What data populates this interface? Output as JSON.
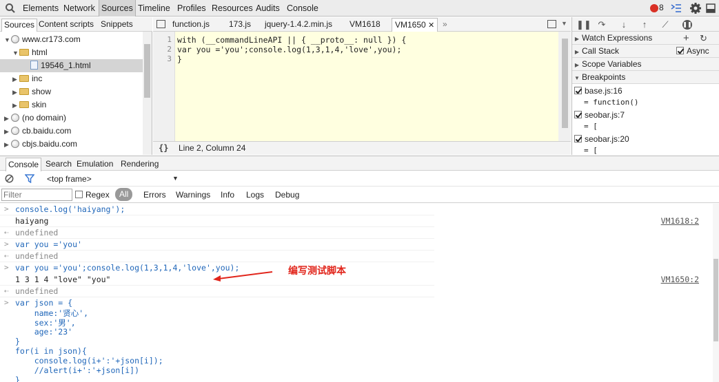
{
  "toolbar": {
    "tabs": [
      "Elements",
      "Network",
      "Sources",
      "Timeline",
      "Profiles",
      "Resources",
      "Audits",
      "Console"
    ],
    "active_tab": "Sources",
    "error_count": "8"
  },
  "navigator": {
    "tabs": [
      "Sources",
      "Content scripts",
      "Snippets"
    ],
    "tree": [
      {
        "label": "www.cr173.com"
      },
      {
        "label": "html"
      },
      {
        "label": "19546_1.html"
      },
      {
        "label": "inc"
      },
      {
        "label": "show"
      },
      {
        "label": "skin"
      },
      {
        "label": "(no domain)"
      },
      {
        "label": "cb.baidu.com"
      },
      {
        "label": "cbjs.baidu.com"
      }
    ]
  },
  "editor": {
    "tabs": [
      "function.js",
      "173.js",
      "jquery-1.4.2.min.js",
      "VM1618",
      "VM1650"
    ],
    "line_numbers": [
      "1",
      "2",
      "3"
    ],
    "lines": [
      "with (__commandLineAPI || { __proto__: null }) {",
      "var you ='you';console.log(1,3,1,4,'love',you);",
      "}"
    ],
    "status": "Line 2, Column 24",
    "format_label": "{}"
  },
  "debugger": {
    "panes": {
      "watch": "Watch Expressions",
      "callstack": "Call Stack",
      "async": "Async",
      "scope": "Scope Variables",
      "breakpoints": "Breakpoints"
    },
    "breakpoints": [
      {
        "file": "base.js:16",
        "code": "= function()"
      },
      {
        "file": "seobar.js:7",
        "code": "= ["
      },
      {
        "file": "seobar.js:20",
        "code": "= ["
      }
    ]
  },
  "drawer": {
    "tabs": [
      "Console",
      "Search",
      "Emulation",
      "Rendering"
    ],
    "frame": "<top frame>",
    "filter_placeholder": "Filter",
    "regex_label": "Regex",
    "levels": [
      "All",
      "Errors",
      "Warnings",
      "Info",
      "Logs",
      "Debug"
    ]
  },
  "console": {
    "lines": [
      {
        "kind": "input",
        "text": "console.log('haiyang');"
      },
      {
        "kind": "log",
        "text": "haiyang",
        "source": "VM1618:2"
      },
      {
        "kind": "result",
        "text": "undefined"
      },
      {
        "kind": "input",
        "text": "var you ='you'"
      },
      {
        "kind": "result",
        "text": "undefined"
      },
      {
        "kind": "input",
        "text": "var you ='you';console.log(1,3,1,4,'love',you);"
      },
      {
        "kind": "log",
        "text": "1 3 1 4 \"love\" \"you\"",
        "source": "VM1650:2"
      },
      {
        "kind": "result",
        "text": "undefined"
      },
      {
        "kind": "input",
        "text": "var json = {"
      },
      {
        "kind": "cont",
        "text": "    name:'贤心',"
      },
      {
        "kind": "cont",
        "text": "    sex:'男',"
      },
      {
        "kind": "cont",
        "text": "    age:'23'"
      },
      {
        "kind": "cont",
        "text": "}"
      },
      {
        "kind": "cont",
        "text": "for(i in json){"
      },
      {
        "kind": "cont",
        "text": "    console.log(i+':'+json[i]);"
      },
      {
        "kind": "cont",
        "text": "    //alert(i+':'+json[i])"
      },
      {
        "kind": "cont",
        "text": "}"
      }
    ],
    "annotation": "编写测试脚本"
  },
  "colors": {
    "annotation": "#e1251b",
    "input_text": "#1f66b9",
    "editor_bg": "#ffffe0"
  }
}
